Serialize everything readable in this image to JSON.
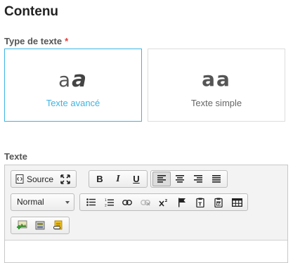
{
  "page": {
    "title": "Contenu"
  },
  "type_field": {
    "label": "Type de texte",
    "required_marker": "*",
    "options": [
      {
        "glyph_a": "a",
        "glyph_b": "a",
        "caption": "Texte avancé",
        "selected": true
      },
      {
        "glyph_a": "a",
        "glyph_b": "a",
        "caption": "Texte simple",
        "selected": false
      }
    ]
  },
  "text_field": {
    "label": "Texte"
  },
  "editor": {
    "toolbar": {
      "source_label": "Source",
      "bold_label": "B",
      "italic_label": "I",
      "underline_label": "U",
      "format_select_value": "Normal"
    },
    "icons": {
      "source": "source-code-icon",
      "maximize": "maximize-icon",
      "align_left": "align-left-icon",
      "align_center": "align-center-icon",
      "align_right": "align-right-icon",
      "justify": "justify-icon",
      "bulleted_list": "bulleted-list-icon",
      "numbered_list": "numbered-list-icon",
      "link": "link-icon",
      "unlink": "unlink-icon",
      "superscript": "superscript-icon",
      "anchor": "flag-anchor-icon",
      "paste_text": "paste-text-icon",
      "paste_word": "paste-word-icon",
      "table": "table-icon",
      "insert_image": "insert-image-icon",
      "insert_media": "insert-media-icon",
      "insert_file": "insert-file-icon"
    }
  },
  "colors": {
    "accent": "#3db4e3",
    "required": "#e23b3b"
  }
}
